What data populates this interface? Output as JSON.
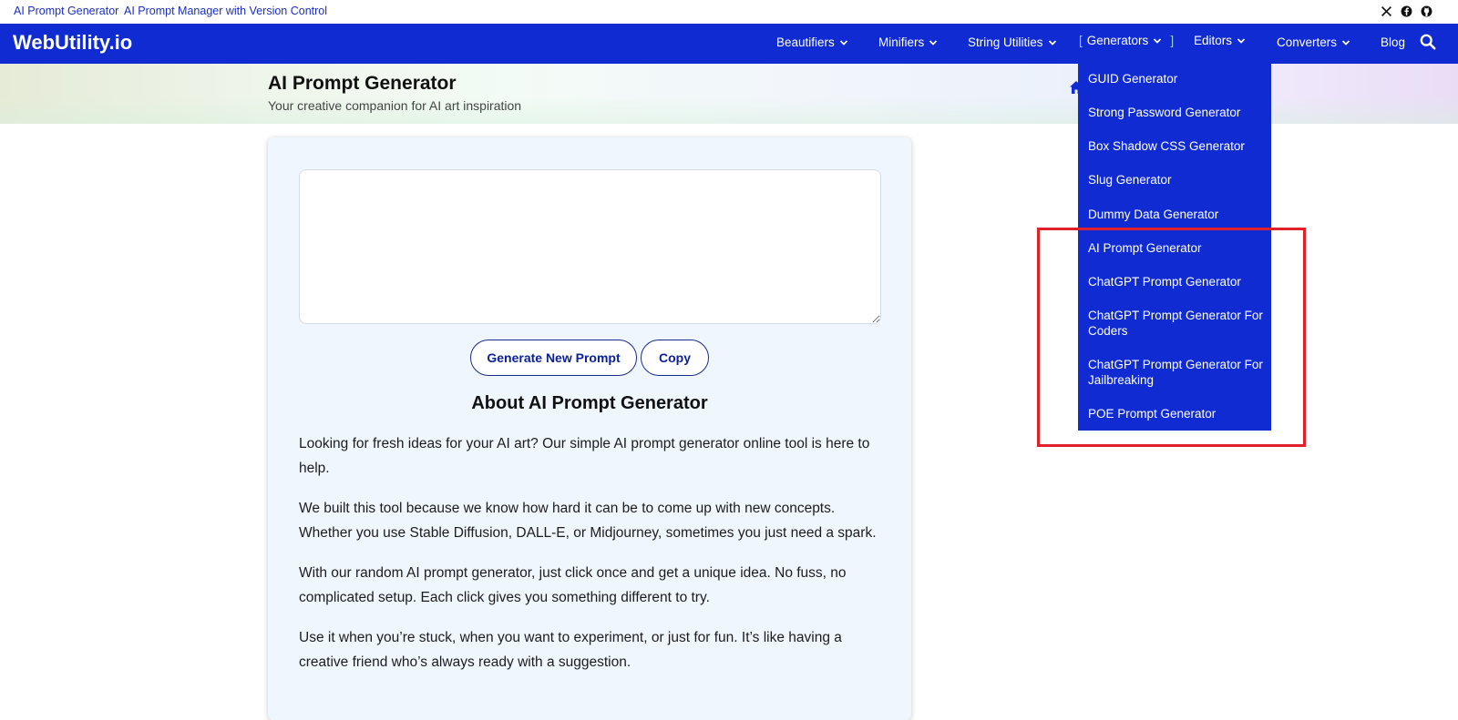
{
  "topbar": {
    "links": [
      "AI Prompt Generator",
      "AI Prompt Manager with Version Control"
    ],
    "social_icons": [
      "x-icon",
      "facebook-icon",
      "github-icon"
    ]
  },
  "navbar": {
    "logo": "WebUtility.io",
    "items": [
      "Beautifiers",
      "Minifiers",
      "String Utilities",
      "Generators",
      "Editors",
      "Converters",
      "Blog"
    ],
    "active_item": "Generators",
    "bracket_left": "[",
    "bracket_right": "]"
  },
  "hero": {
    "title": "AI Prompt Generator",
    "subtitle": "Your creative companion for AI art inspiration"
  },
  "main": {
    "prompt_value": "",
    "generate_label": "Generate New Prompt",
    "copy_label": "Copy",
    "about_title": "About AI Prompt Generator",
    "paragraphs": [
      "Looking for fresh ideas for your AI art? Our simple AI prompt generator online tool is here to help.",
      "We built this tool because we know how hard it can be to come up with new concepts. Whether you use Stable Diffusion, DALL-E, or Midjourney, sometimes you just need a spark.",
      "With our random AI prompt generator, just click once and get a unique idea. No fuss, no complicated setup. Each click gives you something different to try.",
      "Use it when you’re stuck, when you want to experiment, or just for fun. It’s like having a creative friend who’s always ready with a suggestion."
    ]
  },
  "dropdown": {
    "items": [
      "GUID Generator",
      "Strong Password Generator",
      "Box Shadow CSS Generator",
      "Slug Generator",
      "Dummy Data Generator",
      "AI Prompt Generator",
      "ChatGPT Prompt Generator",
      "ChatGPT Prompt Generator For Coders",
      "ChatGPT Prompt Generator For Jailbreaking",
      "POE Prompt Generator"
    ]
  },
  "colors": {
    "nav_bg": "#0f2bd1",
    "link": "#1a2fbf",
    "highlight": "#e0202a",
    "card_bg": "#f0f6fd"
  }
}
